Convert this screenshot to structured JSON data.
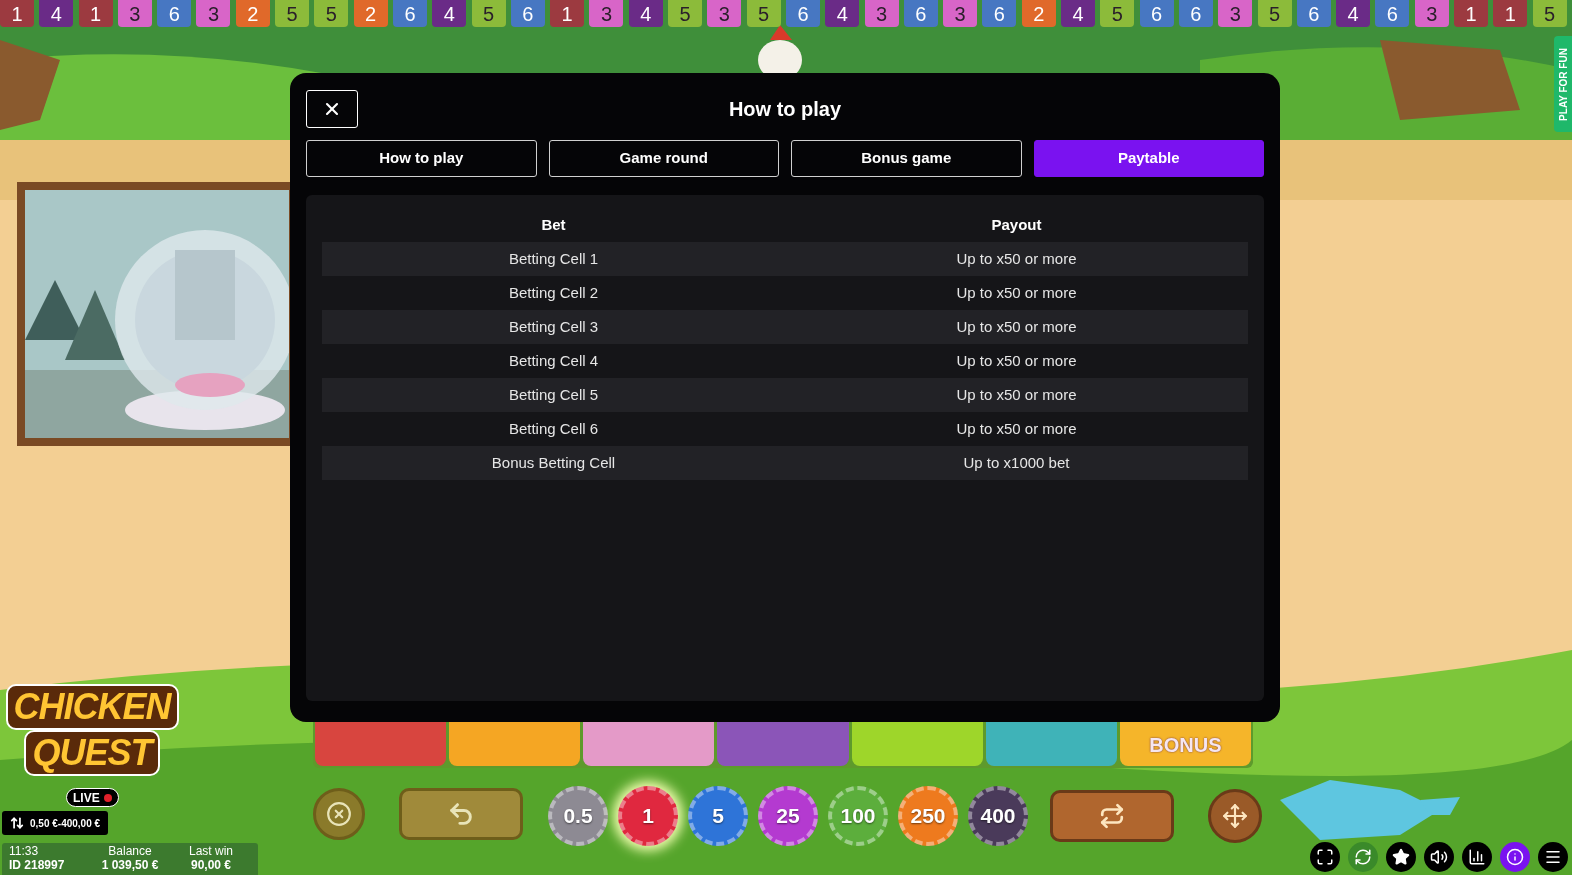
{
  "history_strip": [
    {
      "number": "1",
      "color": "#9c3a40"
    },
    {
      "number": "4",
      "color": "#6a2b87"
    },
    {
      "number": "1",
      "color": "#9c3a40"
    },
    {
      "number": "3",
      "color": "#d865c8"
    },
    {
      "number": "6",
      "color": "#4777c2"
    },
    {
      "number": "3",
      "color": "#d865c8"
    },
    {
      "number": "2",
      "color": "#e0692a"
    },
    {
      "number": "5",
      "color": "#8cbb3a"
    },
    {
      "number": "5",
      "color": "#8cbb3a"
    },
    {
      "number": "2",
      "color": "#e0692a"
    },
    {
      "number": "6",
      "color": "#4777c2"
    },
    {
      "number": "4",
      "color": "#6a2b87"
    },
    {
      "number": "5",
      "color": "#8cbb3a"
    },
    {
      "number": "6",
      "color": "#4777c2"
    },
    {
      "number": "1",
      "color": "#9c3a40"
    },
    {
      "number": "3",
      "color": "#d865c8"
    },
    {
      "number": "4",
      "color": "#6a2b87"
    },
    {
      "number": "5",
      "color": "#8cbb3a"
    },
    {
      "number": "3",
      "color": "#d865c8"
    },
    {
      "number": "5",
      "color": "#8cbb3a"
    },
    {
      "number": "6",
      "color": "#4777c2"
    },
    {
      "number": "4",
      "color": "#6a2b87"
    },
    {
      "number": "3",
      "color": "#d865c8"
    },
    {
      "number": "6",
      "color": "#4777c2"
    },
    {
      "number": "3",
      "color": "#d865c8"
    },
    {
      "number": "6",
      "color": "#4777c2"
    },
    {
      "number": "2",
      "color": "#e0692a"
    },
    {
      "number": "4",
      "color": "#6a2b87"
    },
    {
      "number": "5",
      "color": "#8cbb3a"
    },
    {
      "number": "6",
      "color": "#4777c2"
    },
    {
      "number": "6",
      "color": "#4777c2"
    },
    {
      "number": "3",
      "color": "#d865c8"
    },
    {
      "number": "5",
      "color": "#8cbb3a"
    },
    {
      "number": "6",
      "color": "#4777c2"
    },
    {
      "number": "4",
      "color": "#6a2b87"
    },
    {
      "number": "6",
      "color": "#4777c2"
    },
    {
      "number": "3",
      "color": "#d865c8"
    },
    {
      "number": "1",
      "color": "#9c3a40"
    },
    {
      "number": "1",
      "color": "#9c3a40"
    },
    {
      "number": "5",
      "color": "#8cbb3a"
    }
  ],
  "side_label": "PLAY FOR FUN",
  "modal": {
    "title": "How to play",
    "tabs": [
      {
        "label": "How to play",
        "selected": false
      },
      {
        "label": "Game round",
        "selected": false
      },
      {
        "label": "Bonus game",
        "selected": false
      },
      {
        "label": "Paytable",
        "selected": true
      }
    ],
    "table": {
      "columns": [
        "Bet",
        "Payout"
      ],
      "rows": [
        [
          "Betting Cell 1",
          "Up to x50 or more"
        ],
        [
          "Betting Cell 2",
          "Up to x50 or more"
        ],
        [
          "Betting Cell 3",
          "Up to x50 or more"
        ],
        [
          "Betting Cell 4",
          "Up to x50 or more"
        ],
        [
          "Betting Cell 5",
          "Up to x50 or more"
        ],
        [
          "Betting Cell 6",
          "Up to x50 or more"
        ],
        [
          "Bonus Betting Cell",
          "Up to x1000 bet"
        ]
      ]
    }
  },
  "logo": {
    "lines": [
      "CHICKEN",
      "QUEST"
    ]
  },
  "live_badge": "LIVE",
  "bet_range": "0,50 €-400,00 €",
  "status": {
    "time": "11:33",
    "id": "ID 218997",
    "balance_label": "Balance",
    "balance": "1 039,50 €",
    "last_win_label": "Last win",
    "last_win": "90,00 €"
  },
  "betting_tiles": [
    {
      "kind": "number",
      "color": "#d8453f"
    },
    {
      "kind": "number",
      "color": "#f5a623"
    },
    {
      "kind": "number",
      "color": "#e49ac8"
    },
    {
      "kind": "number",
      "color": "#8b55b8"
    },
    {
      "kind": "number",
      "color": "#9ed62a"
    },
    {
      "kind": "number",
      "color": "#3fb3b8"
    },
    {
      "kind": "bonus",
      "color": "#f5b52a",
      "label": "BONUS"
    }
  ],
  "chips": [
    {
      "value": "0.5",
      "color": "#8d8a93",
      "selected": false
    },
    {
      "value": "1",
      "color": "#e0283f",
      "selected": true
    },
    {
      "value": "5",
      "color": "#2e74d8",
      "selected": false
    },
    {
      "value": "25",
      "color": "#b43ad0",
      "selected": false
    },
    {
      "value": "100",
      "color": "#5cae3c",
      "selected": false
    },
    {
      "value": "250",
      "color": "#ee7a1e",
      "selected": false
    },
    {
      "value": "400",
      "color": "#4a3a5a",
      "selected": false
    }
  ],
  "toolbar": [
    {
      "kind": "fullscreen",
      "selected": false
    },
    {
      "kind": "autoplay",
      "selected": false
    },
    {
      "kind": "favorite",
      "selected": false
    },
    {
      "kind": "sound",
      "selected": false
    },
    {
      "kind": "stats",
      "selected": false
    },
    {
      "kind": "info",
      "selected": true
    },
    {
      "kind": "menu",
      "selected": false
    }
  ]
}
